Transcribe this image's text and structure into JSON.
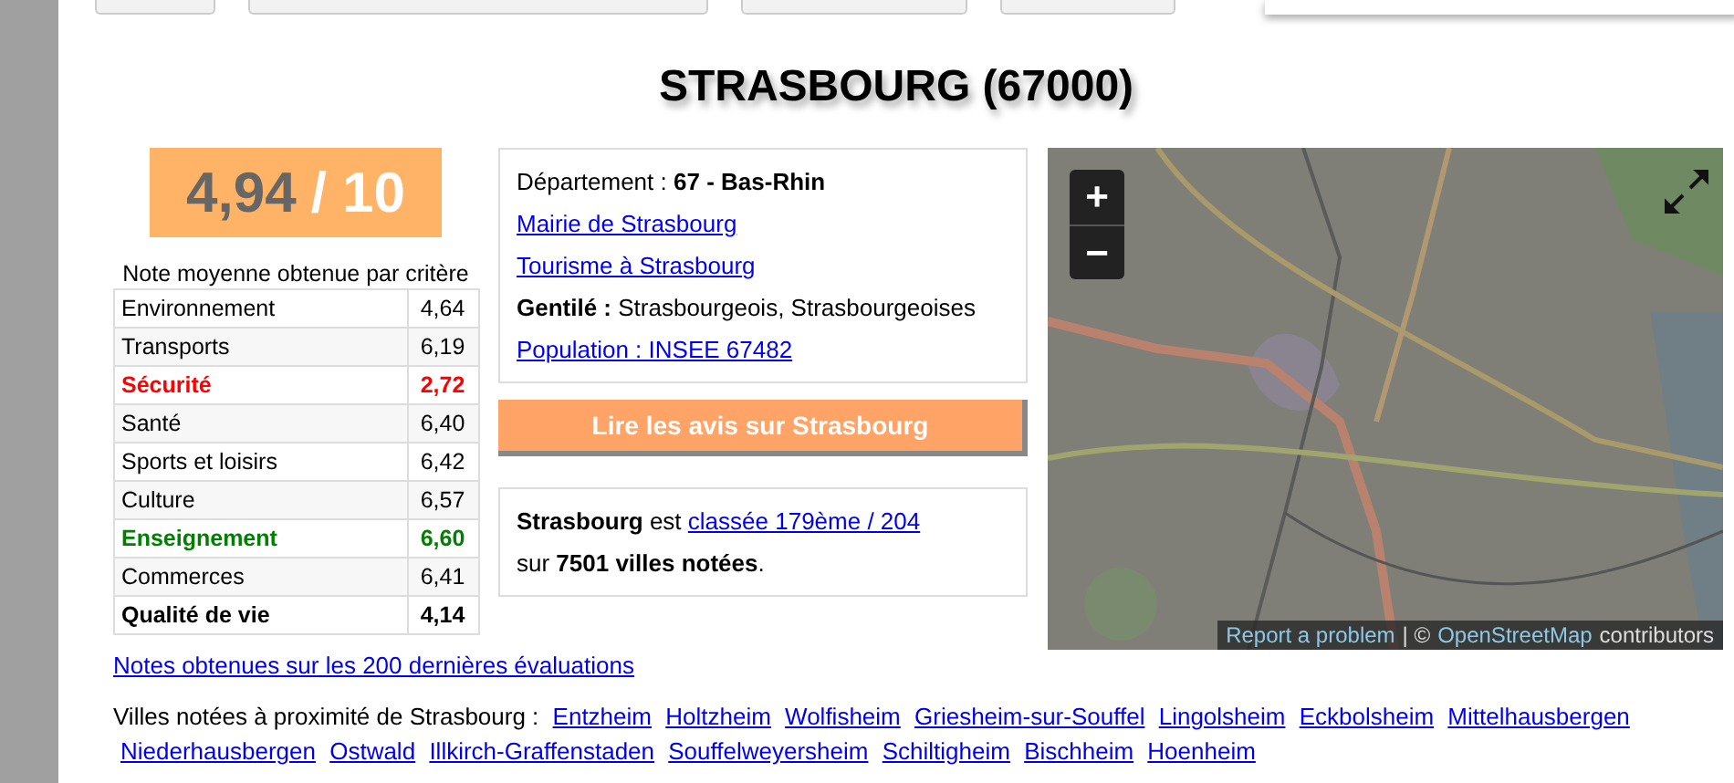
{
  "top_buttons": [
    {
      "kind": "button"
    },
    {
      "kind": "button"
    },
    {
      "kind": "button"
    },
    {
      "kind": "button"
    }
  ],
  "popup": {
    "shown": true
  },
  "title": "STRASBOURG (67000)",
  "score": {
    "value": "4,94",
    "scale": "/ 10"
  },
  "criteria_caption": "Note moyenne obtenue par critère",
  "criteria": [
    {
      "name": "Environnement",
      "value": "4,64",
      "kind": "normal",
      "color": "#000000"
    },
    {
      "name": "Transports",
      "value": "6,19",
      "kind": "normal",
      "color": "#000000"
    },
    {
      "name": "Sécurité",
      "value": "2,72",
      "kind": "highlight",
      "color": "#ff0000"
    },
    {
      "name": "Santé",
      "value": "6,40",
      "kind": "normal",
      "color": "#000000"
    },
    {
      "name": "Sports et loisirs",
      "value": "6,42",
      "kind": "normal",
      "color": "#000000"
    },
    {
      "name": "Culture",
      "value": "6,57",
      "kind": "normal",
      "color": "#000000"
    },
    {
      "name": "Enseignement",
      "value": "6,60",
      "kind": "highlight",
      "color": "#008000"
    },
    {
      "name": "Commerces",
      "value": "6,41",
      "kind": "normal",
      "color": "#000000"
    },
    {
      "name": "Qualité de vie",
      "value": "4,14",
      "kind": "total",
      "color": "#000000"
    }
  ],
  "reviews_link": "Notes obtenues sur les 200 dernières évaluations",
  "info": [
    {
      "kind": "text",
      "text": "Département : **67 - Bas-Rhin**"
    },
    {
      "kind": "link",
      "text": "Mairie de Strasbourg"
    },
    {
      "kind": "link",
      "text": "Tourisme à Strasbourg"
    },
    {
      "kind": "text",
      "text": "**Gentilé :** Strasbourgeois, Strasbourgeoises"
    },
    {
      "kind": "link",
      "text": "Population : INSEE 67482"
    }
  ],
  "reviews_button": "Lire les avis sur Strasbourg",
  "rank": {
    "before": "**Strasbourg** est",
    "link": "classée 179ème / 204",
    "line2": "sur **7501 villes notées**."
  },
  "map": {
    "zoom_in": "+",
    "zoom_out": "−",
    "attribution": [
      {
        "kind": "link",
        "text": "Report a problem"
      },
      {
        "kind": "text",
        "text": "| ©"
      },
      {
        "kind": "link",
        "text": "OpenStreetMap"
      },
      {
        "kind": "text",
        "text": "contributors"
      }
    ]
  },
  "nearby": {
    "label": "Villes notées à proximité de Strasbourg :",
    "cities": [
      "Entzheim",
      "Holtzheim",
      "Wolfisheim",
      "Griesheim-sur-Souffel",
      "Lingolsheim",
      "Eckbolsheim",
      "Mittelhausbergen",
      "Niederhausbergen",
      "Ostwald",
      "Illkirch-Graffenstaden",
      "Souffelweyersheim",
      "Schiltigheim",
      "Bischheim",
      "Hoenheim"
    ]
  }
}
